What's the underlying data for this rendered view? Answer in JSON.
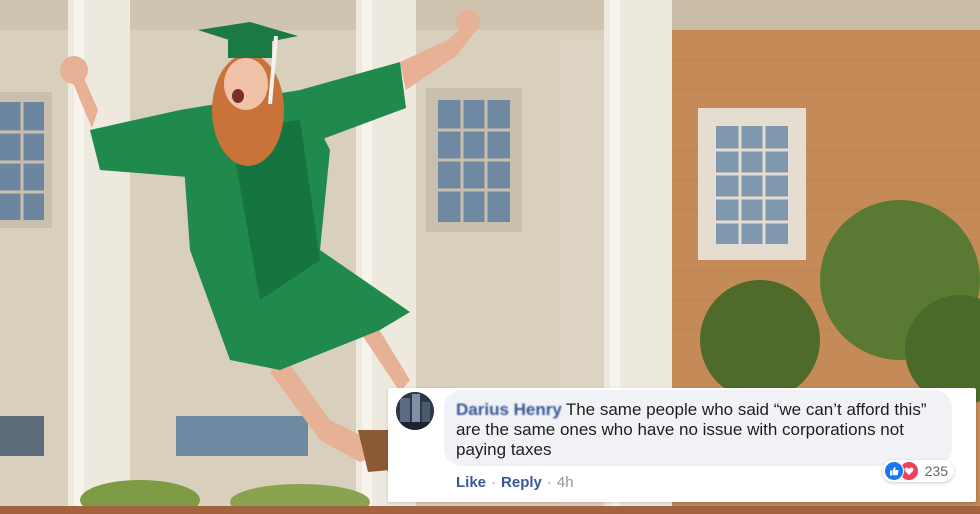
{
  "comment": {
    "author": "Darius Henry",
    "text": "The same people who said “we can’t afford this” are the same ones who have no issue with corporations not paying taxes",
    "reaction_count": "235",
    "actions": {
      "like": "Like",
      "reply": "Reply",
      "timestamp": "4h",
      "separator": "·"
    },
    "icons": {
      "avatar": "profile-photo",
      "like_reaction": "thumbs-up-icon",
      "love_reaction": "heart-icon"
    }
  },
  "colors": {
    "link_blue": "#385898",
    "bubble_bg": "#f0f2f5",
    "like_blue": "#1877f2",
    "love_red": "#f33e58",
    "gown_green": "#1f8a4c",
    "brick": "#c48a57"
  }
}
